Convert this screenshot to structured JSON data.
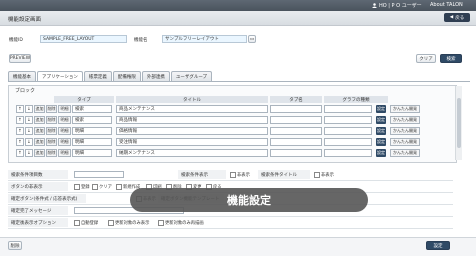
{
  "app": {
    "user_label": "HO | P O ユーザー",
    "about_label": "About TALON",
    "window_title": "機能設定画面",
    "back_label": "戻る"
  },
  "form": {
    "function_id_label": "機能ID",
    "function_id_value": "SAMPLE_FREE_LAYOUT",
    "function_name_label": "機能名",
    "function_name_value": "サンプルフリーレイアウト"
  },
  "actions": {
    "preview": "PREVIEW",
    "clear": "クリア",
    "search": "検索"
  },
  "tabs": [
    {
      "label": "機能基本"
    },
    {
      "label": "アプリケーション"
    },
    {
      "label": "帳票定義"
    },
    {
      "label": "配備権限"
    },
    {
      "label": "外部連携"
    },
    {
      "label": "ユーザグループ"
    }
  ],
  "block": {
    "title": "ブロック",
    "headers": {
      "type": "タイプ",
      "title": "タイトル",
      "tab_name": "タブ名",
      "graph_type": "グラフの種類"
    },
    "row_buttons": {
      "up": "↑",
      "down": "↓",
      "add": "追加",
      "delete": "削除",
      "setting": "設定",
      "simple_dev": "かんたん開発"
    },
    "rows": [
      {
        "kind": "明細",
        "type": "検索",
        "title": "商品メンテナンス"
      },
      {
        "kind": "明細",
        "type": "検索",
        "title": "商品情報"
      },
      {
        "kind": "明細",
        "type": "明細",
        "title": "価格情報"
      },
      {
        "kind": "明細",
        "type": "明細",
        "title": "受注情報"
      },
      {
        "kind": "明細",
        "type": "明細",
        "title": "納期メンテナンス"
      }
    ]
  },
  "settings": {
    "row1": {
      "label_a": "検索条件項目数",
      "label_b": "検索条件表示",
      "label_c": "非表示",
      "label_d": "検索条件タイトル",
      "label_e": "非表示"
    },
    "row2": {
      "label": "ボタンの非表示",
      "opts": [
        "登録",
        "クリア",
        "新規作成",
        "印刷",
        "削除",
        "変更",
        "戻る"
      ]
    },
    "row3": {
      "label": "確定ボタン(条件式 / 応答表示式)",
      "opt_a": "非表示",
      "label_b": "確定ボタン機能テンプレート",
      "opt_b": "表示"
    },
    "row4": {
      "label": "確定完了メッセージ"
    },
    "row5": {
      "label": "確定後表示オプション",
      "opts": [
        "自動登録",
        "更新対象のみ表示",
        "更新対象のみ再描画"
      ]
    }
  },
  "toast": "機能設定",
  "footer": {
    "delete": "削除",
    "save": "設定"
  }
}
